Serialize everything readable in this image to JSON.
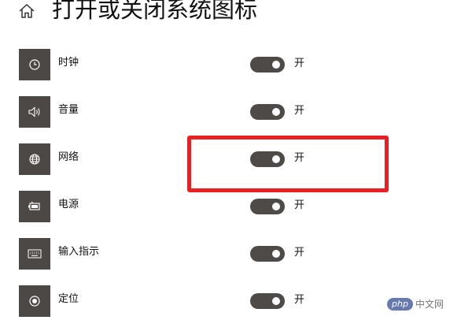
{
  "header": {
    "title": "打开或关闭系统图标",
    "home_icon": "home-icon"
  },
  "items": [
    {
      "label": "时钟",
      "icon": "clock-icon",
      "state": "开",
      "on": true
    },
    {
      "label": "音量",
      "icon": "volume-icon",
      "state": "开",
      "on": true
    },
    {
      "label": "网络",
      "icon": "globe-icon",
      "state": "开",
      "on": true
    },
    {
      "label": "电源",
      "icon": "battery-icon",
      "state": "开",
      "on": true
    },
    {
      "label": "输入指示",
      "icon": "keyboard-icon",
      "state": "开",
      "on": true
    },
    {
      "label": "定位",
      "icon": "location-icon",
      "state": "开",
      "on": true
    }
  ],
  "annotation": {
    "color": "#e81f25",
    "target": "网络"
  },
  "watermark": {
    "badge": "php",
    "text": "中文网"
  },
  "colors": {
    "tile": "#4b4846",
    "toggle_on": "#4d4a48",
    "knob": "#ffffff",
    "text": "#111111"
  }
}
